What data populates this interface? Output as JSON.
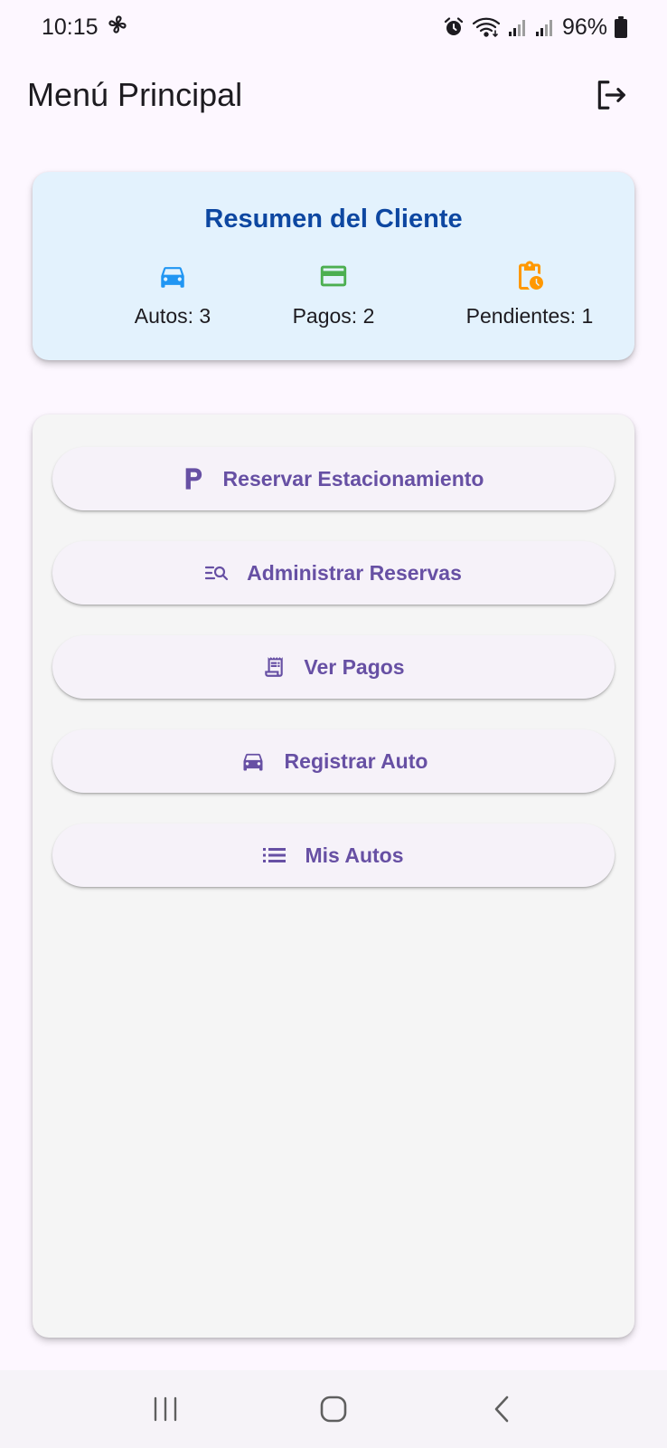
{
  "status_bar": {
    "time": "10:15",
    "battery": "96%",
    "icons": [
      "fan-icon",
      "alarm-icon",
      "wifi-icon",
      "signal-icon",
      "signal-icon",
      "battery-icon"
    ]
  },
  "app_bar": {
    "title": "Menú Principal",
    "logout_icon": "logout-icon"
  },
  "summary": {
    "title": "Resumen del Cliente",
    "stats": [
      {
        "label": "Autos: 3",
        "icon": "car-icon",
        "color": "#2196f3"
      },
      {
        "label": "Pagos: 2",
        "icon": "credit-card-icon",
        "color": "#4caf50"
      },
      {
        "label": "Pendientes: 1",
        "icon": "pending-clipboard-icon",
        "color": "#ff9800"
      }
    ]
  },
  "menu": {
    "buttons": [
      {
        "label": "Reservar Estacionamiento",
        "icon": "parking-icon"
      },
      {
        "label": "Administrar Reservas",
        "icon": "manage-search-icon"
      },
      {
        "label": "Ver Pagos",
        "icon": "receipt-icon"
      },
      {
        "label": "Registrar Auto",
        "icon": "car-icon"
      },
      {
        "label": "Mis Autos",
        "icon": "list-icon"
      }
    ]
  },
  "colors": {
    "background": "#fdf7ff",
    "summary_card": "#e3f2fd",
    "summary_title": "#0d47a1",
    "button_text": "#6750a4",
    "panel": "#f5f5f5"
  },
  "nav_bar": {
    "icons": [
      "recent-apps-icon",
      "home-icon",
      "back-icon"
    ]
  }
}
